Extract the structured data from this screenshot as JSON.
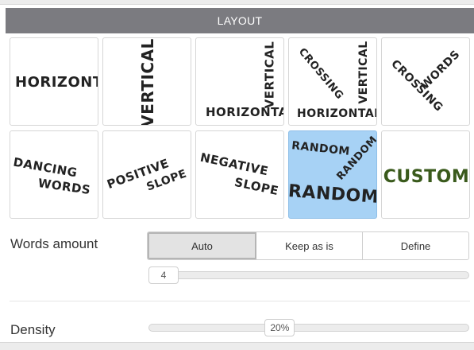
{
  "header": {
    "title": "LAYOUT"
  },
  "layouts": [
    {
      "id": "horizontal",
      "words": [
        "HORIZONTAL"
      ]
    },
    {
      "id": "vertical",
      "words": [
        "VERTICAL"
      ]
    },
    {
      "id": "horizontal-vertical",
      "words": [
        "VERTICAL",
        "HORIZONTAL"
      ]
    },
    {
      "id": "crossing-vertical",
      "words": [
        "CROSSING",
        "VERTICAL",
        "HORIZONTAL"
      ]
    },
    {
      "id": "crossing",
      "words": [
        "WORDS",
        "CROSSING"
      ]
    },
    {
      "id": "dancing",
      "words": [
        "DANCING",
        "WORDS"
      ]
    },
    {
      "id": "positive-slope",
      "words": [
        "POSITIVE",
        "SLOPE"
      ]
    },
    {
      "id": "negative-slope",
      "words": [
        "NEGATIVE",
        "SLOPE"
      ]
    },
    {
      "id": "random",
      "words": [
        "RANDOM",
        "RANDOM",
        "RANDOM"
      ],
      "selected": true
    },
    {
      "id": "custom",
      "words": [
        "CUSTOM"
      ]
    }
  ],
  "words_amount": {
    "label": "Words amount",
    "options": [
      "Auto",
      "Keep as is",
      "Define"
    ],
    "selected": "Auto",
    "value": "4"
  },
  "density": {
    "label": "Density",
    "value": "20%",
    "fraction": 0.4
  },
  "colors": {
    "header": "#7b7b80",
    "selected_tile": "#a7d2f5",
    "custom_text": "#3a5a1c"
  }
}
